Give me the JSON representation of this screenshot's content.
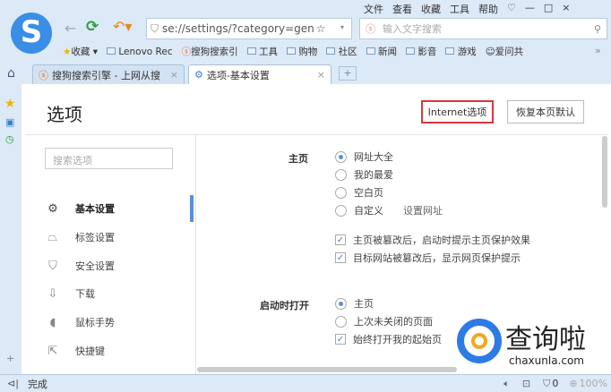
{
  "menu": {
    "items": [
      "文件",
      "查看",
      "收藏",
      "工具",
      "帮助"
    ]
  },
  "address": {
    "value": "se://settings/?category=gen"
  },
  "search": {
    "placeholder": "输入文字搜索"
  },
  "bookmarks": {
    "items": [
      "收藏",
      "Lenovo Rec",
      "搜狗搜索引",
      "工具",
      "购物",
      "社区",
      "新闻",
      "影音",
      "游戏",
      "爱问共"
    ]
  },
  "tabs": [
    {
      "label": "搜狗搜索引擎 - 上网从搜"
    },
    {
      "label": "选项-基本设置"
    }
  ],
  "page": {
    "title": "选项",
    "internet_options": "Internet选项",
    "restore_default": "恢复本页默认",
    "search_placeholder": "搜索选项"
  },
  "nav": [
    {
      "label": "基本设置",
      "icon": "gear-icon"
    },
    {
      "label": "标签设置",
      "icon": "tab-icon"
    },
    {
      "label": "安全设置",
      "icon": "shield-icon"
    },
    {
      "label": "下载",
      "icon": "download-icon"
    },
    {
      "label": "鼠标手势",
      "icon": "mouse-icon"
    },
    {
      "label": "快捷键",
      "icon": "shortcut-icon"
    }
  ],
  "homepage": {
    "label": "主页",
    "options": [
      "网址大全",
      "我的最爱",
      "空白页",
      "自定义"
    ],
    "set_url": "设置网址",
    "checks": [
      "主页被篡改后，启动时提示主页保护效果",
      "目标网站被篡改后，显示网页保护提示"
    ]
  },
  "startup": {
    "label": "启动时打开",
    "options": [
      "主页",
      "上次未关闭的页面"
    ],
    "check": "始终打开我的起始页"
  },
  "status": {
    "text": "完成",
    "blocked": "0",
    "zoom": "100%"
  },
  "watermark": {
    "text": "查询啦",
    "url": "chaxunla.com"
  },
  "colors": {
    "accent": "#5b8fd6",
    "highlight_border": "#d9363e"
  }
}
